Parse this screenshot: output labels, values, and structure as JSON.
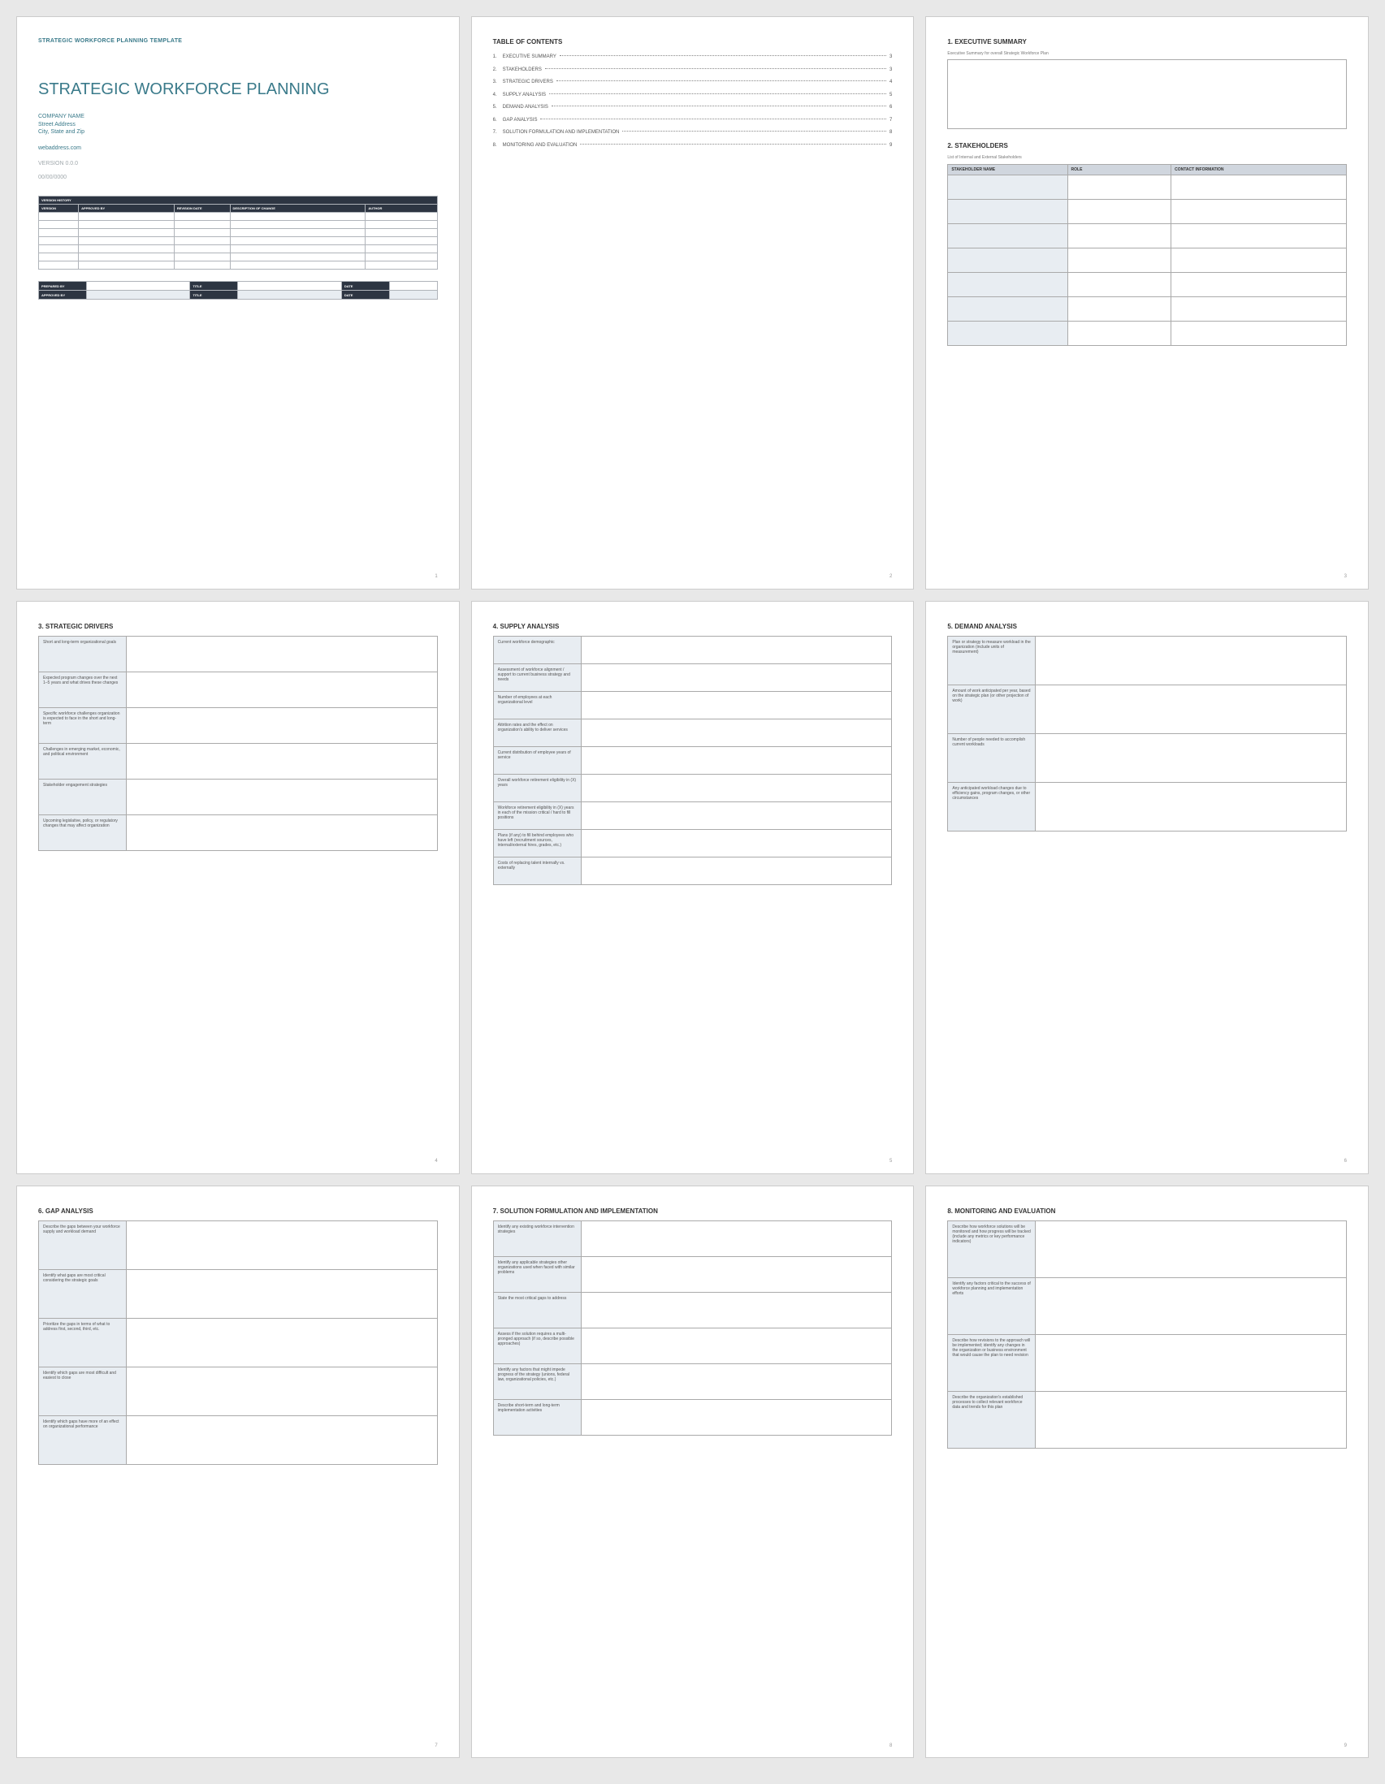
{
  "doc": {
    "header": "STRATEGIC WORKFORCE PLANNING TEMPLATE",
    "title": "STRATEGIC WORKFORCE PLANNING",
    "company": "COMPANY NAME",
    "street": "Street Address",
    "city": "City, State and Zip",
    "web": "webaddress.com",
    "version": "VERSION 0.0.0",
    "date": "00/00/0000"
  },
  "version_history": {
    "title": "VERSION HISTORY",
    "cols": [
      "VERSION",
      "APPROVED BY",
      "REVISION DATE",
      "DESCRIPTION OF CHANGE",
      "AUTHOR"
    ]
  },
  "signoff": {
    "prepared": "PREPARED BY",
    "approved": "APPROVED BY",
    "title": "TITLE",
    "date": "DATE"
  },
  "toc": {
    "heading": "TABLE OF CONTENTS",
    "items": [
      {
        "n": "1.",
        "label": "EXECUTIVE SUMMARY",
        "page": "3"
      },
      {
        "n": "2.",
        "label": "STAKEHOLDERS",
        "page": "3"
      },
      {
        "n": "3.",
        "label": "STRATEGIC DRIVERS",
        "page": "4"
      },
      {
        "n": "4.",
        "label": "SUPPLY ANALYSIS",
        "page": "5"
      },
      {
        "n": "5.",
        "label": "DEMAND ANALYSIS",
        "page": "6"
      },
      {
        "n": "6.",
        "label": "GAP ANALYSIS",
        "page": "7"
      },
      {
        "n": "7.",
        "label": "SOLUTION FORMULATION AND IMPLEMENTATION",
        "page": "8"
      },
      {
        "n": "8.",
        "label": "MONITORING AND EVALUATION",
        "page": "9"
      }
    ]
  },
  "exec": {
    "heading": "1.  EXECUTIVE SUMMARY",
    "note": "Executive Summary for overall Strategic Workforce Plan"
  },
  "stakeholders": {
    "heading": "2.  STAKEHOLDERS",
    "note": "List of Internal and External Stakeholders",
    "cols": [
      "STAKEHOLDER NAME",
      "ROLE",
      "CONTACT INFORMATION"
    ]
  },
  "drivers": {
    "heading": "3.  STRATEGIC DRIVERS",
    "rows": [
      "Short and long-term organizational goals",
      "Expected program changes over the next 1–5 years and what drives these changes",
      "Specific workforce challenges organization is expected to face in the short and long-term",
      "Challenges in emerging market, economic, and political environment",
      "Stakeholder engagement strategies",
      "Upcoming legislative, policy, or regulatory changes that may affect organization"
    ]
  },
  "supply": {
    "heading": "4.  SUPPLY ANALYSIS",
    "rows": [
      "Current workforce demographic",
      "Assessment of workforce alignment / support to current business strategy and needs",
      "Number of employees at each organizational level",
      "Attrition rates and the effect on organization's ability to deliver services",
      "Current distribution of employee years of service",
      "Overall workforce retirement eligibility in (X) years",
      "Workforce retirement eligibility in (X) years in each of the mission critical / hard to fill positions",
      "Plans (if any) to fill behind employees who have left (recruitment sources, internal/external hires, grades, etc.)",
      "Costs of replacing talent internally vs. externally"
    ]
  },
  "demand": {
    "heading": "5.  DEMAND ANALYSIS",
    "rows": [
      "Plan or strategy to measure workload in the organization (include units of measurement)",
      "Amount of work anticipated per year, based on the strategic plan (or other projection of work)",
      "Number of people needed to accomplish current workloads",
      "Any anticipated workload changes due to efficiency gains, program changes, or other circumstances"
    ]
  },
  "gap": {
    "heading": "6.  GAP ANALYSIS",
    "rows": [
      "Describe the gaps between your workforce supply and workload demand",
      "Identify what gaps are most critical considering the strategic goals",
      "Prioritize the gaps in terms of what to address first, second, third, etc.",
      "Identify which gaps are most difficult and easiest to close",
      "Identify which gaps have more of an effect on organizational performance"
    ]
  },
  "solution": {
    "heading": "7.  SOLUTION FORMULATION AND IMPLEMENTATION",
    "rows": [
      "Identify any existing workforce intervention strategies",
      "Identify any applicable strategies other organizations used when faced with similar problems",
      "State the most critical gaps to address",
      "Assess if the solution requires a multi-pronged approach (if so, describe possible approaches)",
      "Identify any factors that might impede progress of the strategy (unions, federal law, organizational policies, etc.)",
      "Describe short-term and long-term implementation activities"
    ]
  },
  "monitor": {
    "heading": "8.  MONITORING AND EVALUATION",
    "rows": [
      "Describe how workforce solutions will be monitored and how progress will be tracked (include any metrics or key performance indicators)",
      "Identify any factors critical to the success of workforce planning and implementation efforts",
      "Describe how revisions to the approach will be implemented; identify any changes in the organization or business environment that would cause the plan to need revision",
      "Describe the organization's established processes to collect relevant workforce data and trends for this plan"
    ]
  },
  "page_numbers": [
    "1",
    "2",
    "3",
    "4",
    "5",
    "6",
    "7",
    "8",
    "9"
  ]
}
